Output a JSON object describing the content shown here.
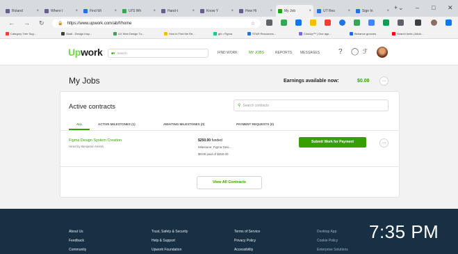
{
  "browser": {
    "tabs": [
      {
        "label": "Roland",
        "color": "#6b5b95"
      },
      {
        "label": "Where I",
        "color": "#6b5b95"
      },
      {
        "label": "Find Wi",
        "color": "#1a73e8"
      },
      {
        "label": "UI'S Wh",
        "color": "#34a853"
      },
      {
        "label": "Hand-t",
        "color": "#6b5b95"
      },
      {
        "label": "Know Y",
        "color": "#6b5b95"
      },
      {
        "label": "How Hi",
        "color": "#6b5b95"
      },
      {
        "label": "My Job",
        "color": "#14a800"
      },
      {
        "label": "UT Res",
        "color": "#1a73e8"
      },
      {
        "label": "Sign In",
        "color": "#1a73e8"
      }
    ],
    "url": "https://www.upwork.com/ab/f/home",
    "bookmarks": [
      "Category Tree Sug...",
      "Studi - Design Insp...",
      "UX Web Design Tu...",
      "How to Find the Re...",
      "gfx • Figma",
      "STAR Resources...",
      "ClickUp™ | One app...",
      "Behance grooves",
      "Search fonts | Adob..."
    ]
  },
  "header": {
    "logo_up": "Up",
    "logo_work": "work",
    "search_placeholder": "Search",
    "nav": [
      "FIND WORK",
      "MY JOBS",
      "REPORTS",
      "MESSAGES"
    ],
    "help_icon": "?"
  },
  "page": {
    "title": "My Jobs",
    "earnings_label": "Earnings available now:",
    "earnings_value": "$0.00",
    "more": "···"
  },
  "contracts": {
    "title": "Active contracts",
    "search_placeholder": "Search contracts",
    "tabs": [
      "ALL",
      "ACTIVE MILESTONES (1)",
      "AWAITING MILESTONES (0)",
      "PAYMENT REQUESTS (0)"
    ],
    "rows": [
      {
        "job_title": "Figma Design System Creation",
        "hired_by": "Hired by Benjamin Hersh",
        "funded_amount": "$250.00",
        "funded_label": "funded",
        "milestone": "Milestone: Figma Desi...",
        "paid": "$0.00 paid of $250.00",
        "action": "Submit Work for Payment"
      }
    ],
    "view_all": "View All Contracts"
  },
  "footer": {
    "columns": [
      [
        "About Us",
        "Feedback",
        "Community"
      ],
      [
        "Trust, Safety & Security",
        "Help & Support",
        "Upwork Foundation"
      ],
      [
        "Terms of Service",
        "Privacy Policy",
        "Accessibility"
      ],
      [
        "Desktop App",
        "Cookie Policy",
        "Enterprise Solutions"
      ]
    ]
  },
  "overlay": {
    "clock": "7:35 PM"
  },
  "colors": {
    "brand_green": "#37a000",
    "logo_green": "#6fda44",
    "footer_bg": "#183044"
  }
}
